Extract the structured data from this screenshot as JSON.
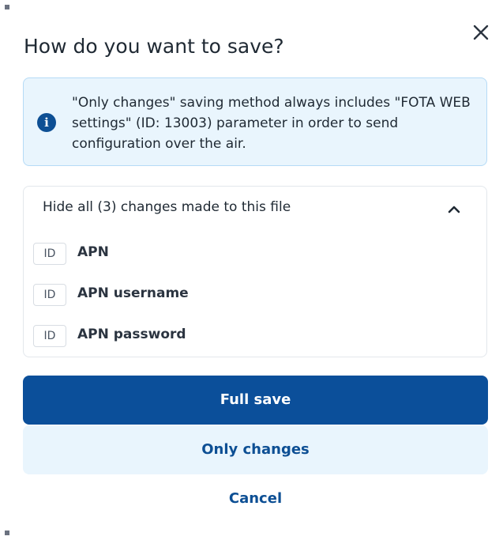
{
  "dialog": {
    "title": "How do you want to save?",
    "close_icon": "close-icon"
  },
  "info": {
    "icon": "info-icon",
    "icon_glyph": "i",
    "message": "\"Only changes\" saving method always includes \"FOTA WEB settings\" (ID: 13003) parameter in order to send configuration over the air."
  },
  "changes": {
    "header_label": "Hide all (3) changes made to this file",
    "expanded": true,
    "toggle_icon": "chevron-up-icon",
    "items": [
      {
        "badge": "ID",
        "name": "APN"
      },
      {
        "badge": "ID",
        "name": "APN username"
      },
      {
        "badge": "ID",
        "name": "APN password"
      }
    ]
  },
  "actions": {
    "full_save_label": "Full save",
    "only_changes_label": "Only changes",
    "cancel_label": "Cancel"
  },
  "colors": {
    "primary": "#0b4f9a",
    "info_background": "#e9f5fd",
    "info_border": "#b5dbf6"
  }
}
